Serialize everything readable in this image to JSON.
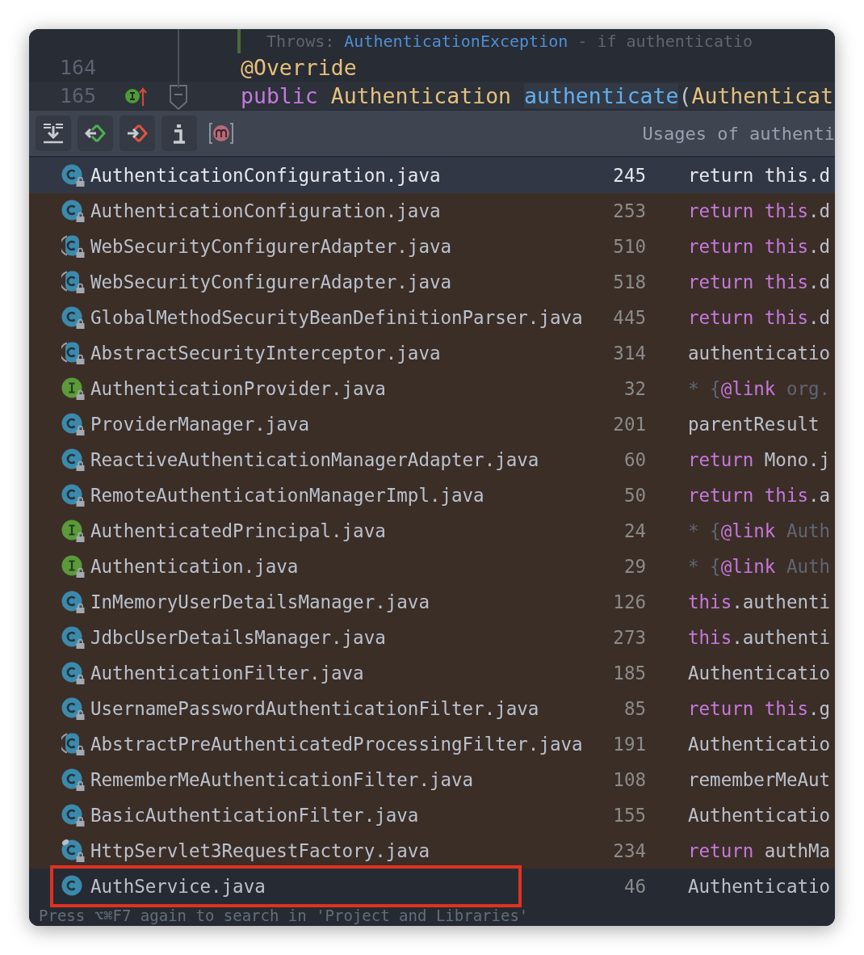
{
  "editor": {
    "lines": [
      {
        "current": false,
        "override_marker": false,
        "tokens": [
          {
            "text": "Throws: ",
            "kind": "comment"
          },
          {
            "text": "AuthenticationException",
            "kind": "doc-link"
          },
          {
            "text": " - if authenticatio",
            "kind": "comment"
          }
        ]
      },
      {
        "number": "164",
        "current": false,
        "override_marker": false,
        "tokens": [
          {
            "text": "@Override",
            "kind": "annotation"
          }
        ]
      },
      {
        "number": "165",
        "current": true,
        "override_marker": true,
        "tokens": [
          {
            "text": "public ",
            "kind": "keyword"
          },
          {
            "text": "Authentication ",
            "kind": "type"
          },
          {
            "text": "authenticate",
            "kind": "usage"
          },
          {
            "text": "(",
            "kind": "plain"
          },
          {
            "text": "Authenticat",
            "kind": "type"
          }
        ]
      }
    ]
  },
  "toolbar": {
    "title": "Usages of authenti"
  },
  "usages": [
    {
      "kind": "class",
      "locked": true,
      "selected": true,
      "outlined": false,
      "file": "AuthenticationConfiguration.java",
      "line": "245",
      "code": [
        {
          "text": "return this.d",
          "kind": "plain"
        }
      ]
    },
    {
      "kind": "class",
      "locked": true,
      "selected": false,
      "outlined": false,
      "file": "AuthenticationConfiguration.java",
      "line": "253",
      "code": [
        {
          "text": "return this",
          "kind": "keyword"
        },
        {
          "text": ".d",
          "kind": "plain"
        }
      ]
    },
    {
      "kind": "abstract",
      "locked": true,
      "selected": false,
      "outlined": false,
      "file": "WebSecurityConfigurerAdapter.java",
      "line": "510",
      "code": [
        {
          "text": "return this",
          "kind": "keyword"
        },
        {
          "text": ".d",
          "kind": "plain"
        }
      ]
    },
    {
      "kind": "abstract",
      "locked": true,
      "selected": false,
      "outlined": false,
      "file": "WebSecurityConfigurerAdapter.java",
      "line": "518",
      "code": [
        {
          "text": "return this",
          "kind": "keyword"
        },
        {
          "text": ".d",
          "kind": "plain"
        }
      ]
    },
    {
      "kind": "class",
      "locked": true,
      "selected": false,
      "outlined": false,
      "file": "GlobalMethodSecurityBeanDefinitionParser.java",
      "line": "445",
      "code": [
        {
          "text": "return this",
          "kind": "keyword"
        },
        {
          "text": ".d",
          "kind": "plain"
        }
      ]
    },
    {
      "kind": "abstract",
      "locked": true,
      "selected": false,
      "outlined": false,
      "file": "AbstractSecurityInterceptor.java",
      "line": "314",
      "code": [
        {
          "text": "authenticatio",
          "kind": "plain"
        }
      ]
    },
    {
      "kind": "interface",
      "locked": true,
      "selected": false,
      "outlined": false,
      "file": "AuthenticationProvider.java",
      "line": "32",
      "code": [
        {
          "text": "* {",
          "kind": "comment"
        },
        {
          "text": "@link",
          "kind": "keyword"
        },
        {
          "text": " org.",
          "kind": "comment"
        }
      ]
    },
    {
      "kind": "class",
      "locked": true,
      "selected": false,
      "outlined": false,
      "file": "ProviderManager.java",
      "line": "201",
      "code": [
        {
          "text": "parentResult",
          "kind": "plain"
        }
      ]
    },
    {
      "kind": "class",
      "locked": true,
      "selected": false,
      "outlined": false,
      "file": "ReactiveAuthenticationManagerAdapter.java",
      "line": "60",
      "code": [
        {
          "text": "return",
          "kind": "keyword"
        },
        {
          "text": " Mono.j",
          "kind": "plain"
        }
      ]
    },
    {
      "kind": "class",
      "locked": true,
      "selected": false,
      "outlined": false,
      "file": "RemoteAuthenticationManagerImpl.java",
      "line": "50",
      "code": [
        {
          "text": "return this",
          "kind": "keyword"
        },
        {
          "text": ".a",
          "kind": "plain"
        }
      ]
    },
    {
      "kind": "interface",
      "locked": true,
      "selected": false,
      "outlined": false,
      "file": "AuthenticatedPrincipal.java",
      "line": "24",
      "code": [
        {
          "text": "* {",
          "kind": "comment"
        },
        {
          "text": "@link",
          "kind": "keyword"
        },
        {
          "text": " Auth",
          "kind": "comment"
        }
      ]
    },
    {
      "kind": "interface",
      "locked": true,
      "selected": false,
      "outlined": false,
      "file": "Authentication.java",
      "line": "29",
      "code": [
        {
          "text": "* {",
          "kind": "comment"
        },
        {
          "text": "@link",
          "kind": "keyword"
        },
        {
          "text": " Auth",
          "kind": "comment"
        }
      ]
    },
    {
      "kind": "class",
      "locked": true,
      "selected": false,
      "outlined": false,
      "file": "InMemoryUserDetailsManager.java",
      "line": "126",
      "code": [
        {
          "text": "this",
          "kind": "keyword"
        },
        {
          "text": ".authenti",
          "kind": "plain"
        }
      ]
    },
    {
      "kind": "class",
      "locked": true,
      "selected": false,
      "outlined": false,
      "file": "JdbcUserDetailsManager.java",
      "line": "273",
      "code": [
        {
          "text": "this",
          "kind": "keyword"
        },
        {
          "text": ".authenti",
          "kind": "plain"
        }
      ]
    },
    {
      "kind": "class",
      "locked": true,
      "selected": false,
      "outlined": false,
      "file": "AuthenticationFilter.java",
      "line": "185",
      "code": [
        {
          "text": "Authenticatio",
          "kind": "plain"
        }
      ]
    },
    {
      "kind": "class",
      "locked": true,
      "selected": false,
      "outlined": false,
      "file": "UsernamePasswordAuthenticationFilter.java",
      "line": "85",
      "code": [
        {
          "text": "return this",
          "kind": "keyword"
        },
        {
          "text": ".g",
          "kind": "plain"
        }
      ]
    },
    {
      "kind": "abstract",
      "locked": true,
      "selected": false,
      "outlined": false,
      "file": "AbstractPreAuthenticatedProcessingFilter.java",
      "line": "191",
      "code": [
        {
          "text": "Authenticatio",
          "kind": "plain"
        }
      ]
    },
    {
      "kind": "class",
      "locked": true,
      "selected": false,
      "outlined": false,
      "file": "RememberMeAuthenticationFilter.java",
      "line": "108",
      "code": [
        {
          "text": "rememberMeAut",
          "kind": "plain"
        }
      ]
    },
    {
      "kind": "class",
      "locked": true,
      "selected": false,
      "outlined": false,
      "file": "BasicAuthenticationFilter.java",
      "line": "155",
      "code": [
        {
          "text": "Authenticatio",
          "kind": "plain"
        }
      ]
    },
    {
      "kind": "tagged",
      "locked": true,
      "selected": false,
      "outlined": false,
      "file": "HttpServlet3RequestFactory.java",
      "line": "234",
      "code": [
        {
          "text": "return",
          "kind": "keyword"
        },
        {
          "text": " authMa",
          "kind": "plain"
        }
      ]
    },
    {
      "kind": "class",
      "locked": false,
      "selected": false,
      "outlined": true,
      "file": "AuthService.java",
      "line": "46",
      "code": [
        {
          "text": "Authenticatio",
          "kind": "plain"
        }
      ]
    }
  ],
  "footer": {
    "hint": "Press ⌥⌘F7 again to search in 'Project and Libraries'"
  }
}
